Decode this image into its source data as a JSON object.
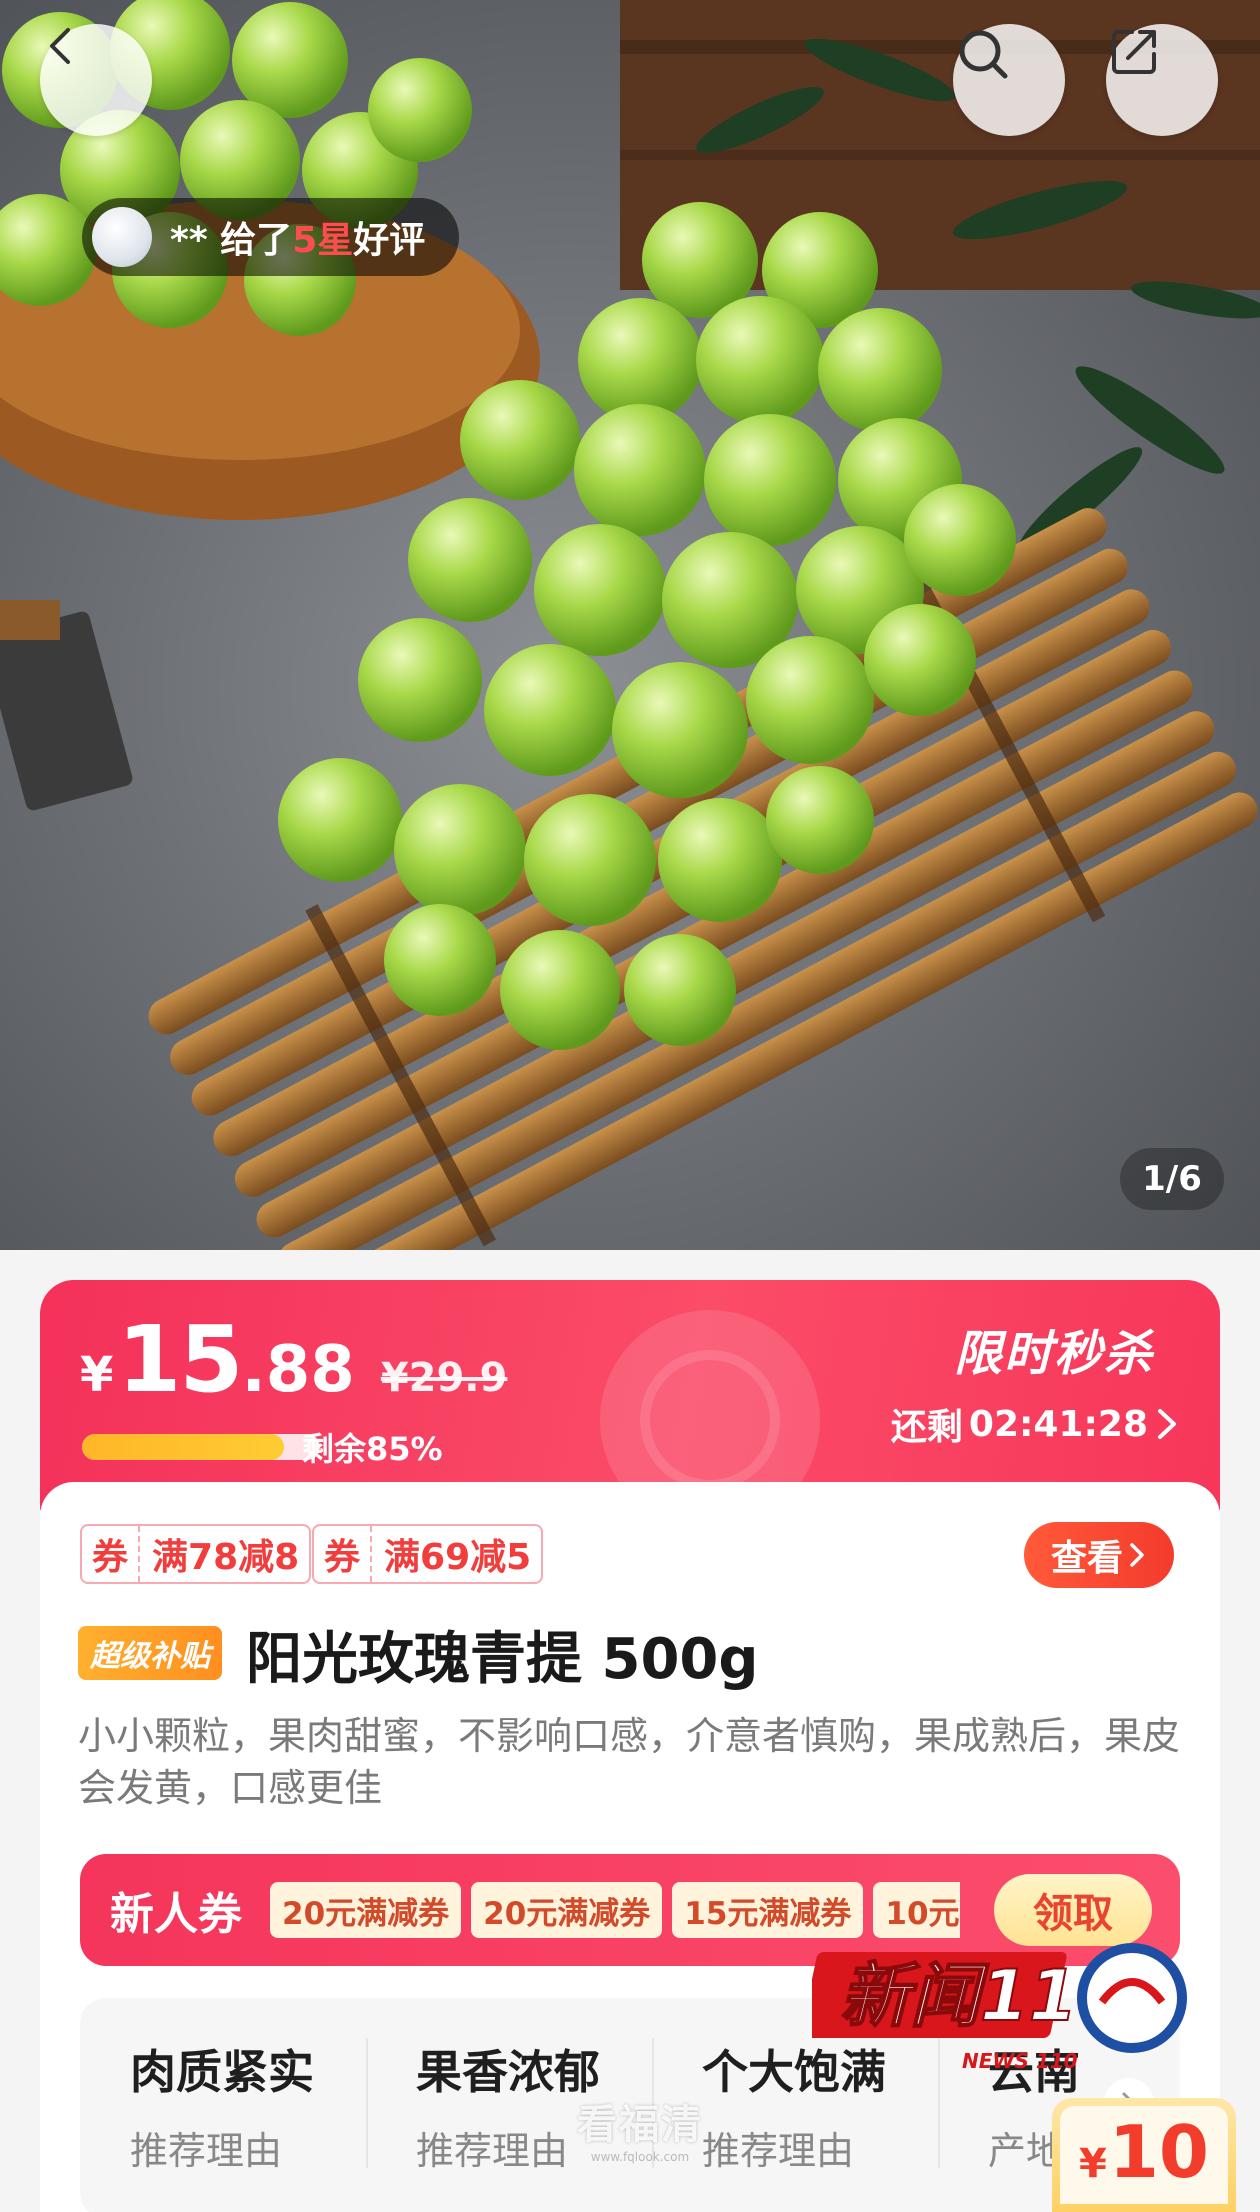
{
  "hero": {
    "review": {
      "prefix": "** 给了",
      "stars": "5星",
      "suffix": "好评"
    },
    "page_indicator": "1/6",
    "icons": {
      "back": "back-arrow-icon",
      "search": "search-icon",
      "share": "share-icon"
    }
  },
  "flash_sale": {
    "currency": "¥",
    "price_int": "15",
    "price_dec": ".88",
    "original_price": "¥29.9",
    "stock_fraction": 0.85,
    "stock_text": "剩余85%",
    "title": "限时秒杀",
    "countdown_label": "还剩",
    "countdown": "02:41:28",
    "colors": {
      "accent": "#f4315a",
      "progress": "#ffb628"
    }
  },
  "coupons": [
    {
      "tag": "券",
      "label": "满78减8"
    },
    {
      "tag": "券",
      "label": "满69减5"
    }
  ],
  "view_button": "查看",
  "product": {
    "badge": "超级补贴",
    "title": "阳光玫瑰青提 500g",
    "description": "小小颗粒，果肉甜蜜，不影响口感，介意者慎购，果成熟后，果皮会发黄，口感更佳"
  },
  "newbie": {
    "label": "新人券",
    "coupons": [
      "20元满减券",
      "20元满减券",
      "15元满减券",
      "10元"
    ],
    "claim": "领取"
  },
  "reasons": [
    {
      "title": "肉质紧实",
      "subtitle": "推荐理由"
    },
    {
      "title": "果香浓郁",
      "subtitle": "推荐理由"
    },
    {
      "title": "个大饱满",
      "subtitle": "推荐理由"
    },
    {
      "title": "云南",
      "subtitle": "产地"
    }
  ],
  "watermarks": {
    "news_logo": "新闻110",
    "news_sub": "NEWS 110",
    "site_name": "看福清",
    "site_url": "www.fqlook.com"
  },
  "floating_price": {
    "currency": "¥",
    "amount": "10"
  }
}
